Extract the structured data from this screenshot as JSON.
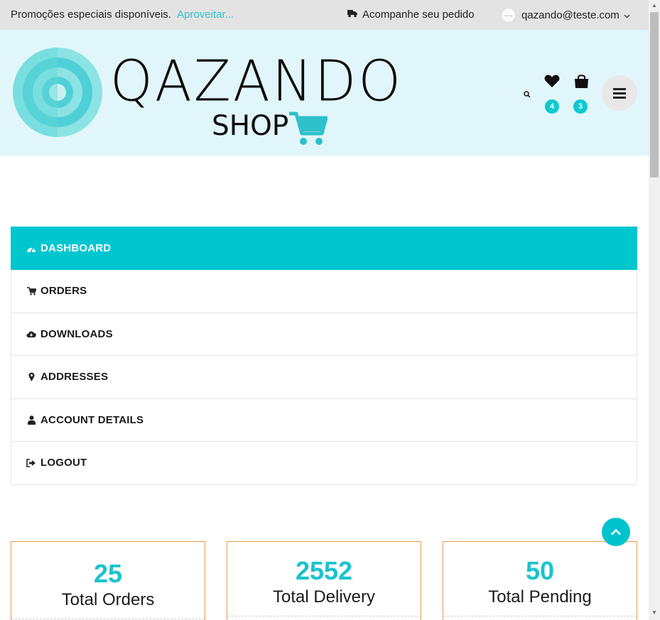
{
  "topbar": {
    "promo_text": "Promoções especiais disponíveis.",
    "promo_link": "Aproveitar...",
    "track_label": "Acompanhe seu pedido",
    "user_email": "qazando@teste.com",
    "avatar_text": "user-img"
  },
  "header": {
    "logo_word": "QAZANDO",
    "logo_sub": "SHOP",
    "wishlist_count": "4",
    "cart_count": "3"
  },
  "nav": {
    "items": [
      {
        "label": "DASHBOARD",
        "icon": "dashboard-icon"
      },
      {
        "label": "ORDERS",
        "icon": "cart-icon"
      },
      {
        "label": "DOWNLOADS",
        "icon": "cloud-download-icon"
      },
      {
        "label": "ADDRESSES",
        "icon": "map-pin-icon"
      },
      {
        "label": "ACCOUNT DETAILS",
        "icon": "user-icon"
      },
      {
        "label": "LOGOUT",
        "icon": "sign-out-icon"
      }
    ]
  },
  "stats": [
    {
      "value": "25",
      "label": "Total Orders"
    },
    {
      "value": "2552",
      "label": "Total Delivery"
    },
    {
      "value": "50",
      "label": "Total Pending"
    }
  ],
  "colors": {
    "accent": "#00c6cf",
    "header_bg": "#e1f6fb",
    "topbar_bg": "#e3e3e3",
    "card_border": "#e59b4d"
  }
}
